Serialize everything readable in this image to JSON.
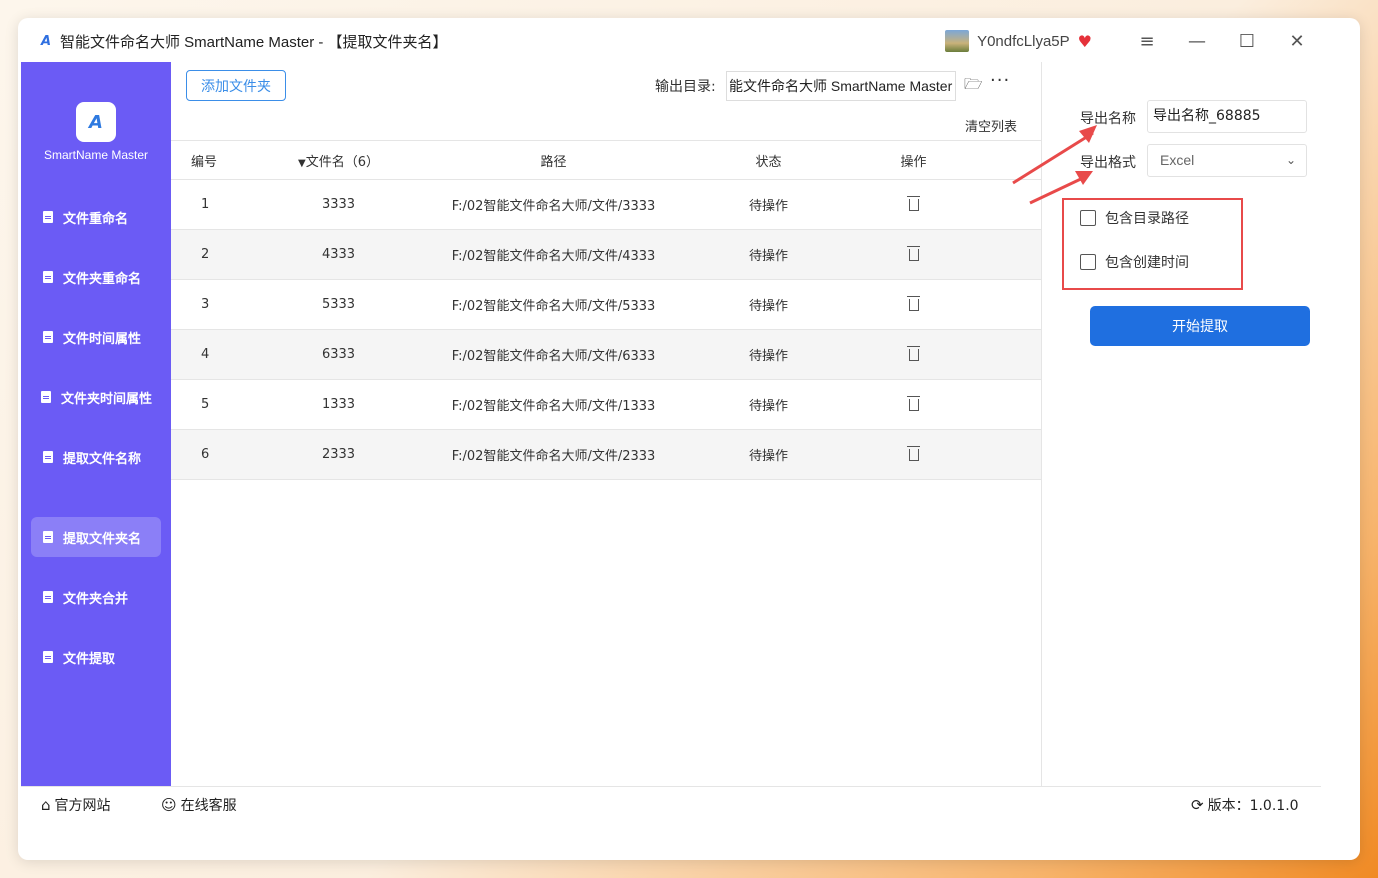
{
  "window": {
    "title": "智能文件命名大师 SmartName Master - 【提取文件夹名】",
    "username": "Y0ndfcLlya5P",
    "minimize_icon": "minimize-icon",
    "maximize_icon": "maximize-icon",
    "close_icon": "close-icon"
  },
  "sidebar": {
    "logo_text": "SmartName Master",
    "items": [
      {
        "label": "文件重命名"
      },
      {
        "label": "文件夹重命名"
      },
      {
        "label": "文件时间属性"
      },
      {
        "label": "文件夹时间属性"
      },
      {
        "label": "提取文件名称"
      },
      {
        "label": "提取文件夹名"
      },
      {
        "label": "文件夹合并"
      },
      {
        "label": "文件提取"
      }
    ],
    "active_index": 5
  },
  "toolbar": {
    "add_folder": "添加文件夹",
    "output_label": "输出目录:",
    "output_value": "能文件命名大师 SmartName Master",
    "clear_list": "清空列表"
  },
  "table": {
    "headers": {
      "index": "编号",
      "name": "文件名（6）",
      "path": "路径",
      "status": "状态",
      "action": "操作"
    },
    "rows": [
      {
        "index": "1",
        "name": "3333",
        "path": "F:/02智能文件命名大师/文件/3333",
        "status": "待操作"
      },
      {
        "index": "2",
        "name": "4333",
        "path": "F:/02智能文件命名大师/文件/4333",
        "status": "待操作"
      },
      {
        "index": "3",
        "name": "5333",
        "path": "F:/02智能文件命名大师/文件/5333",
        "status": "待操作"
      },
      {
        "index": "4",
        "name": "6333",
        "path": "F:/02智能文件命名大师/文件/6333",
        "status": "待操作"
      },
      {
        "index": "5",
        "name": "1333",
        "path": "F:/02智能文件命名大师/文件/1333",
        "status": "待操作"
      },
      {
        "index": "6",
        "name": "2333",
        "path": "F:/02智能文件命名大师/文件/2333",
        "status": "待操作"
      }
    ]
  },
  "panel": {
    "export_name_label": "导出名称",
    "export_name_value": "导出名称_68885",
    "export_format_label": "导出格式",
    "export_format_value": "Excel",
    "include_dir_path": "包含目录路径",
    "include_create_time": "包含创建时间",
    "start_button": "开始提取"
  },
  "footer": {
    "website": "官方网站",
    "support": "在线客服",
    "version": "版本：1.0.1.0"
  },
  "colors": {
    "sidebar": "#6b5bf5",
    "primary": "#1f6fe0",
    "highlight_border": "#e84a4a"
  }
}
